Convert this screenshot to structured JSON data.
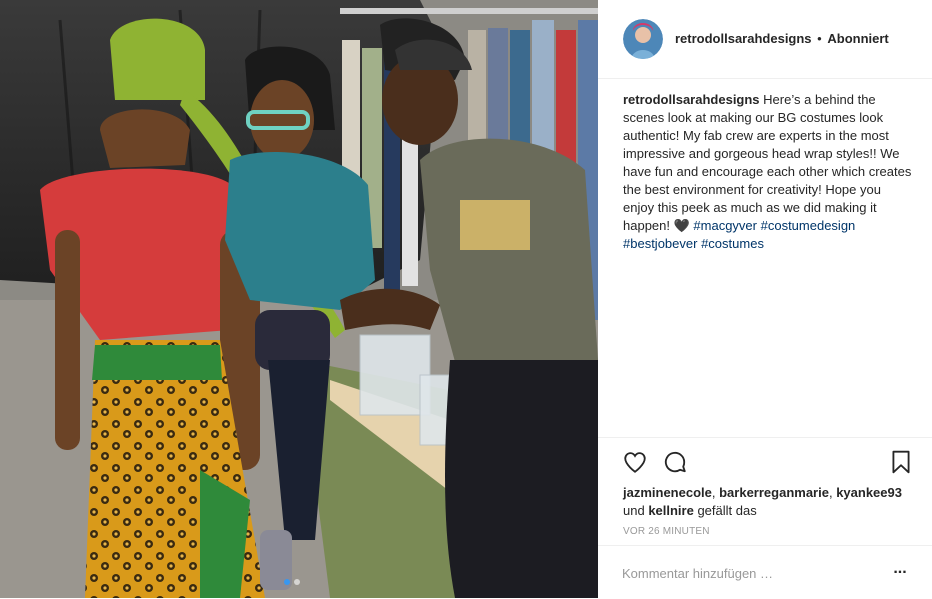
{
  "post": {
    "username": "retrodollsarahdesigns",
    "separator": "•",
    "follow_status": "Abonniert",
    "caption": {
      "username": "retrodollsarahdesigns",
      "text": " Here’s a behind the scenes look at making our BG costumes look authentic! My fab crew are experts in the most impressive and gorgeous head wrap styles!! We have fun and encourage each other which creates the best environment for creativity! Hope you enjoy this peek as much as we did making it happen! 🖤 ",
      "hashtags": [
        "#macgyver",
        "#costumedesign",
        "#bestjobever",
        "#costumes"
      ]
    },
    "likes": {
      "user1": "jazminenecole",
      "sep1": ", ",
      "user2": "barkerreganmarie",
      "sep2": ", ",
      "user3": "kyankee93",
      "and": " und ",
      "user4": "kellnire",
      "suffix": " gefällt das"
    },
    "timestamp": "vor 26 Minuten",
    "comment_placeholder": "Kommentar hinzufügen …",
    "more_label": "..."
  },
  "icons": {
    "like": "heart-icon",
    "comment": "comment-icon",
    "save": "bookmark-icon",
    "more": "more-options-icon"
  },
  "colors": {
    "text": "#262626",
    "hashtag": "#003569",
    "muted": "#999999",
    "divider": "#efefef"
  },
  "carousel": {
    "current": 1,
    "total": 2
  }
}
